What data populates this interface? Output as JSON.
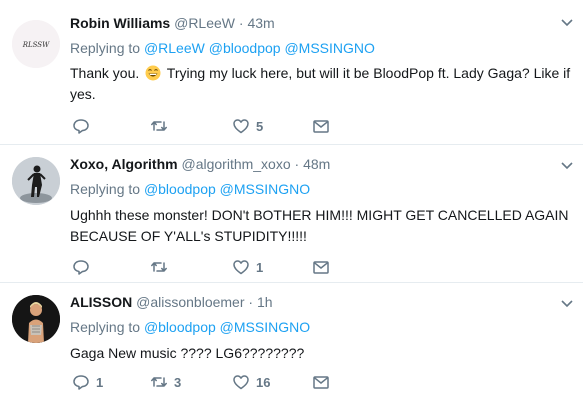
{
  "tweets": [
    {
      "name": "Robin Williams",
      "handle": "@RLeeW",
      "dot": "·",
      "time": "43m",
      "replying_prefix": "Replying to",
      "mentions": [
        "@RLeeW",
        "@bloodpop",
        "@MSSINGNO"
      ],
      "avatar_text": "RLSSW",
      "text_before_emoji": "Thank you.",
      "emoji": "grinning-face-emoji",
      "text_after_emoji": "Trying my luck here, but will it be BloodPop ft. Lady Gaga? Like if yes.",
      "reply_count": "",
      "retweet_count": "",
      "like_count": "5"
    },
    {
      "name": "Xoxo, Algorithm",
      "handle": "@algorithm_xoxo",
      "dot": "·",
      "time": "48m",
      "replying_prefix": "Replying to",
      "mentions": [
        "@bloodpop",
        "@MSSINGNO"
      ],
      "text": "Ughhh these monster! DON't BOTHER HIM!!! MIGHT GET CANCELLED AGAIN BECAUSE OF Y'ALL's STUPIDITY!!!!!",
      "reply_count": "",
      "retweet_count": "",
      "like_count": "1"
    },
    {
      "name": "ALISSON",
      "handle": "@alissonbloemer",
      "dot": "·",
      "time": "1h",
      "replying_prefix": "Replying to",
      "mentions": [
        "@bloodpop",
        "@MSSINGNO"
      ],
      "text": "Gaga New music ???? LG6????????",
      "reply_count": "1",
      "retweet_count": "3",
      "like_count": "16"
    }
  ],
  "icons": {
    "reply": "reply-icon",
    "retweet": "retweet-icon",
    "like": "heart-icon",
    "dm": "envelope-icon",
    "caret": "chevron-down-icon"
  },
  "colors": {
    "link": "#1da1f2",
    "muted": "#657786",
    "text": "#14171a",
    "divider": "#e6ecf0"
  }
}
